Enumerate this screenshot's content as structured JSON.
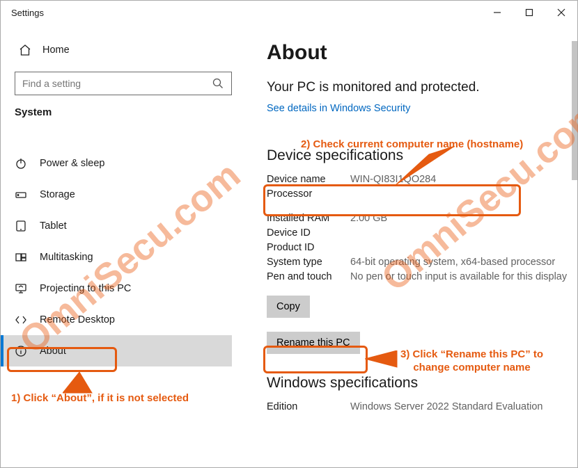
{
  "window_title": "Settings",
  "sidebar": {
    "home_label": "Home",
    "search_placeholder": "Find a setting",
    "group_label": "System",
    "items": [
      {
        "label": "Power & sleep",
        "icon": "power-icon"
      },
      {
        "label": "Storage",
        "icon": "storage-icon"
      },
      {
        "label": "Tablet",
        "icon": "tablet-icon"
      },
      {
        "label": "Multitasking",
        "icon": "multitasking-icon"
      },
      {
        "label": "Projecting to this PC",
        "icon": "projecting-icon"
      },
      {
        "label": "Remote Desktop",
        "icon": "remote-desktop-icon"
      },
      {
        "label": "About",
        "icon": "about-icon"
      }
    ]
  },
  "main": {
    "title": "About",
    "subtitle": "Your PC is monitored and protected.",
    "security_link": "See details in Windows Security",
    "device_spec_heading": "Device specifications",
    "specs": {
      "device_name_label": "Device name",
      "device_name_value": "WIN-QI83I1QO284",
      "processor_label": "Processor",
      "ram_label": "Installed RAM",
      "ram_value": "2.00 GB",
      "device_id_label": "Device ID",
      "product_id_label": "Product ID",
      "system_type_label": "System type",
      "system_type_value": "64-bit operating system, x64-based processor",
      "pen_touch_label": "Pen and touch",
      "pen_touch_value": "No pen or touch input is available for this display"
    },
    "copy_btn": "Copy",
    "rename_btn": "Rename this PC",
    "windows_spec_heading": "Windows specifications",
    "edition_label": "Edition",
    "edition_value": "Windows Server 2022 Standard Evaluation"
  },
  "annotations": {
    "a1": "1) Click “About”, if it is not selected",
    "a2": "2) Check current computer name (hostname)",
    "a3_l1": "3) Click “Rename this PC” to",
    "a3_l2": "change computer name"
  },
  "watermark_parts": {
    "p1": "OmniSecu.com",
    "p2": "OmniSecu.com"
  }
}
